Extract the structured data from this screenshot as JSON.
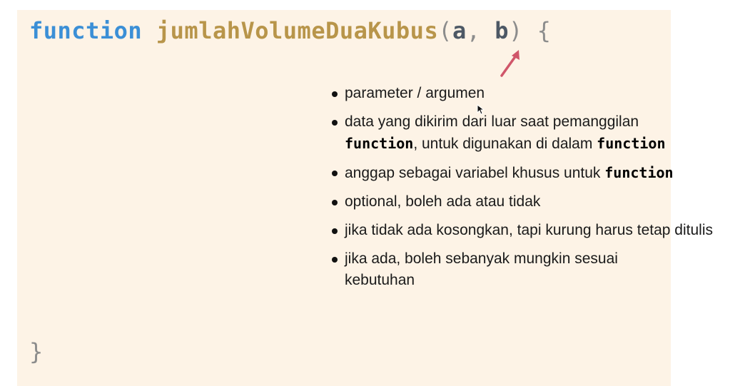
{
  "code": {
    "keyword": "function",
    "function_name": "jumlahVolumeDuaKubus",
    "open_paren": "(",
    "param_a": "a",
    "comma": ",",
    "param_b": "b",
    "close_paren": ")",
    "open_brace": "{",
    "close_brace": "}"
  },
  "notes": {
    "item1": "parameter / argumen",
    "item2_line1": "data yang dikirim dari luar saat pemanggilan",
    "item2_code1": "function",
    "item2_mid": ", untuk digunakan di dalam ",
    "item2_code2": "function",
    "item3_text": "anggap sebagai variabel khusus untuk ",
    "item3_code": "function",
    "item4": "optional, boleh ada atau tidak",
    "item5": "jika tidak ada kosongkan, tapi kurung harus tetap ditulis",
    "item6": "jika ada, boleh sebanyak mungkin sesuai kebutuhan"
  },
  "colors": {
    "panel_bg": "#fdf3e6",
    "keyword": "#3b8fd6",
    "function_name": "#b8954a",
    "arrow": "#d0566a"
  },
  "icons": {
    "arrow": "arrow-up-right-icon",
    "cursor": "mouse-cursor-icon"
  }
}
